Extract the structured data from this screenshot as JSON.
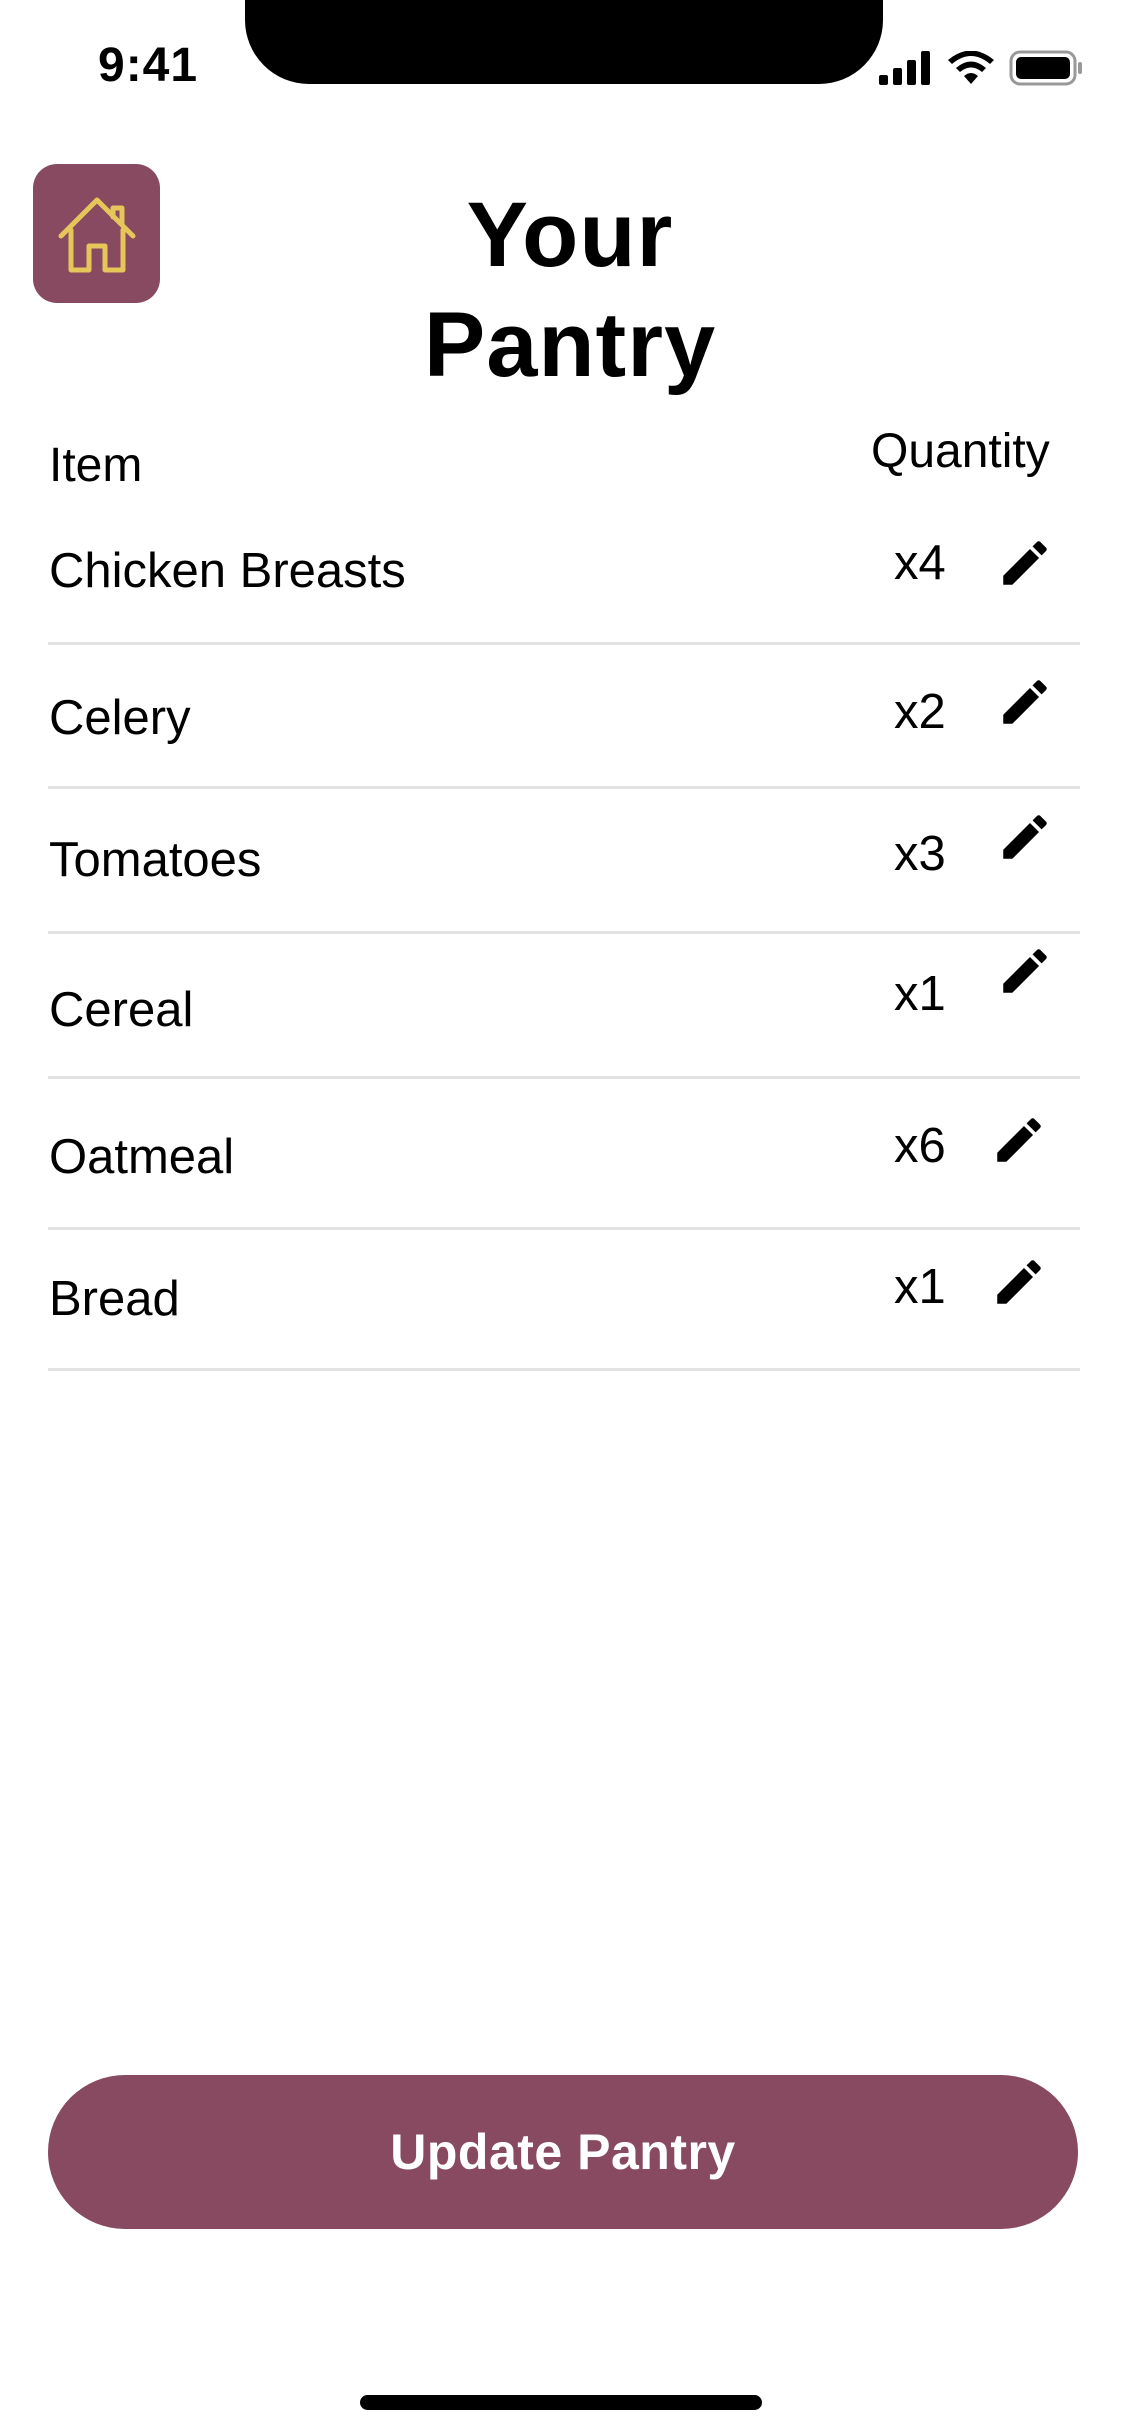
{
  "status_bar": {
    "time": "9:41",
    "icons": [
      "cellular-signal-icon",
      "wifi-icon",
      "battery-icon"
    ]
  },
  "header": {
    "title": "Your Pantry",
    "home_icon": "home-icon"
  },
  "table": {
    "headers": {
      "item": "Item",
      "quantity": "Quantity"
    },
    "rows": [
      {
        "name": "Chicken Breasts",
        "quantity": "x4"
      },
      {
        "name": "Celery",
        "quantity": "x2"
      },
      {
        "name": "Tomatoes",
        "quantity": "x3"
      },
      {
        "name": "Cereal",
        "quantity": "x1"
      },
      {
        "name": "Oatmeal",
        "quantity": "x6"
      },
      {
        "name": "Bread",
        "quantity": "x1"
      }
    ],
    "edit_icon": "pencil-icon"
  },
  "actions": {
    "update_label": "Update Pantry"
  },
  "colors": {
    "accent": "#874a60",
    "home_icon_stroke": "#e6c65a",
    "divider": "#e3e3e3"
  }
}
